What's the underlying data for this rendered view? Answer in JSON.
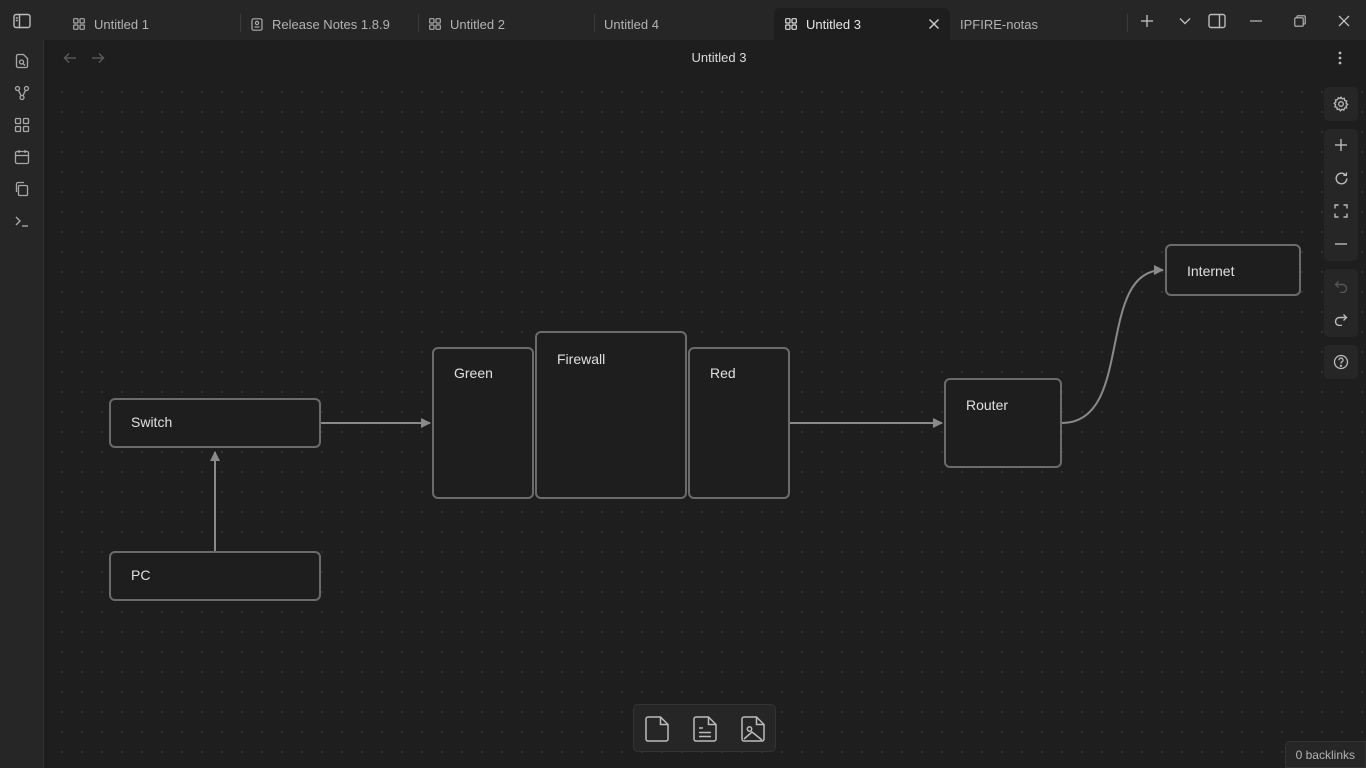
{
  "tabs": [
    {
      "label": "Untitled 1",
      "icon": "canvas-icon"
    },
    {
      "label": "Release Notes 1.8.9",
      "icon": "release-notes-icon"
    },
    {
      "label": "Untitled 2",
      "icon": "canvas-icon"
    },
    {
      "label": "Untitled 4",
      "icon": ""
    },
    {
      "label": "Untitled 3",
      "icon": "canvas-icon",
      "active": true
    },
    {
      "label": "IPFIRE-notas",
      "icon": ""
    }
  ],
  "header": {
    "title": "Untitled 3"
  },
  "nodes": {
    "switch": "Switch",
    "pc": "PC",
    "green": "Green",
    "firewall": "Firewall",
    "red": "Red",
    "router": "Router",
    "internet": "Internet"
  },
  "status": {
    "backlinks": "0 backlinks"
  },
  "colors": {
    "background": "#1e1e1e",
    "panel": "#262626",
    "border": "#6b6b6b",
    "text": "#dadada"
  }
}
